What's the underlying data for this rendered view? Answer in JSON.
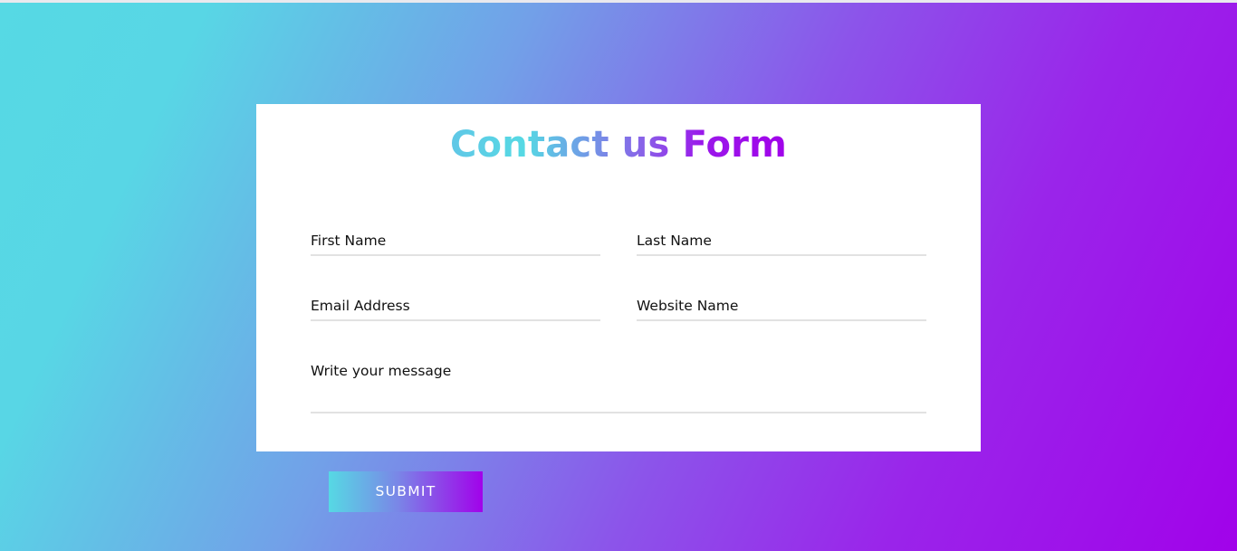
{
  "form": {
    "title": "Contact us Form",
    "fields": {
      "first_name": {
        "label": "First Name"
      },
      "last_name": {
        "label": "Last Name"
      },
      "email": {
        "label": "Email Address"
      },
      "website": {
        "label": "Website Name"
      },
      "message": {
        "label": "Write your message"
      }
    },
    "submit_label": "SUBMIT"
  },
  "colors": {
    "gradient_start": "#56d9e4",
    "gradient_end": "#a102ea",
    "card_background": "#ffffff",
    "field_underline": "#e2e2e2",
    "label_text": "#111111"
  }
}
